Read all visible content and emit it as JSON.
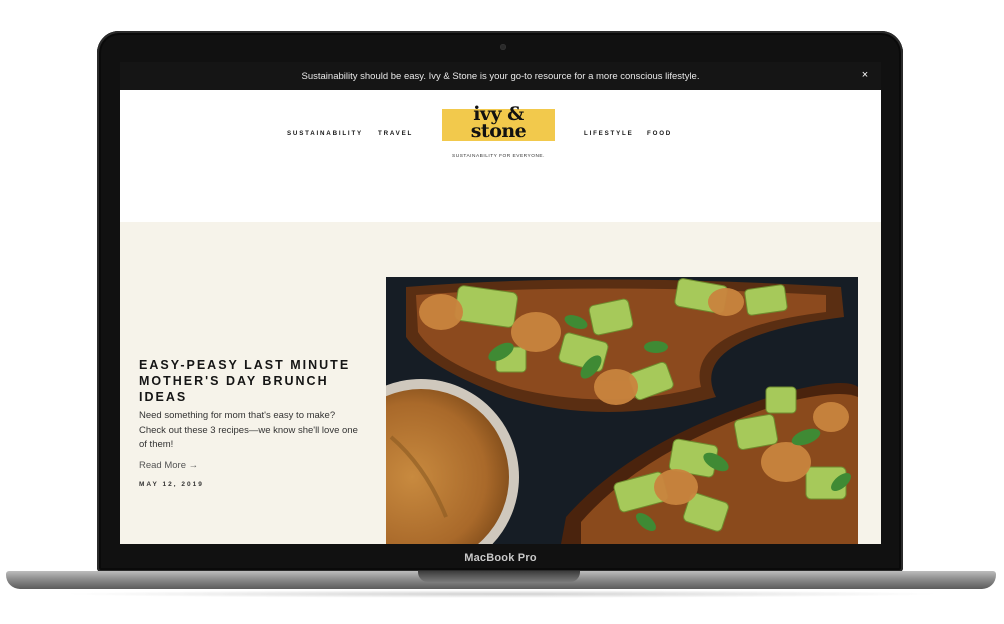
{
  "device": {
    "label": "MacBook Pro"
  },
  "announcement": {
    "text": "Sustainability should be easy. Ivy & Stone is your go-to resource for a more conscious lifestyle.",
    "close_label": "×"
  },
  "nav": {
    "left": [
      "SUSTAINABILITY",
      "TRAVEL"
    ],
    "right": [
      "LIFESTYLE",
      "FOOD"
    ]
  },
  "logo": {
    "line1": "ivy &",
    "line2": "stone",
    "tagline": "SUSTAINABILITY FOR EVERYONE.",
    "accent_color": "#f2c94c"
  },
  "post": {
    "title": "EASY-PEASY LAST MINUTE MOTHER'S DAY BRUNCH IDEAS",
    "excerpt": "Need something for mom that's easy to make? Check out these 3 recipes—we know she'll love one of them!",
    "read_more": "Read More →",
    "date": "MAY 12, 2019"
  },
  "colors": {
    "hero_bg": "#f6f3ea",
    "announcement_bg": "#151515"
  }
}
